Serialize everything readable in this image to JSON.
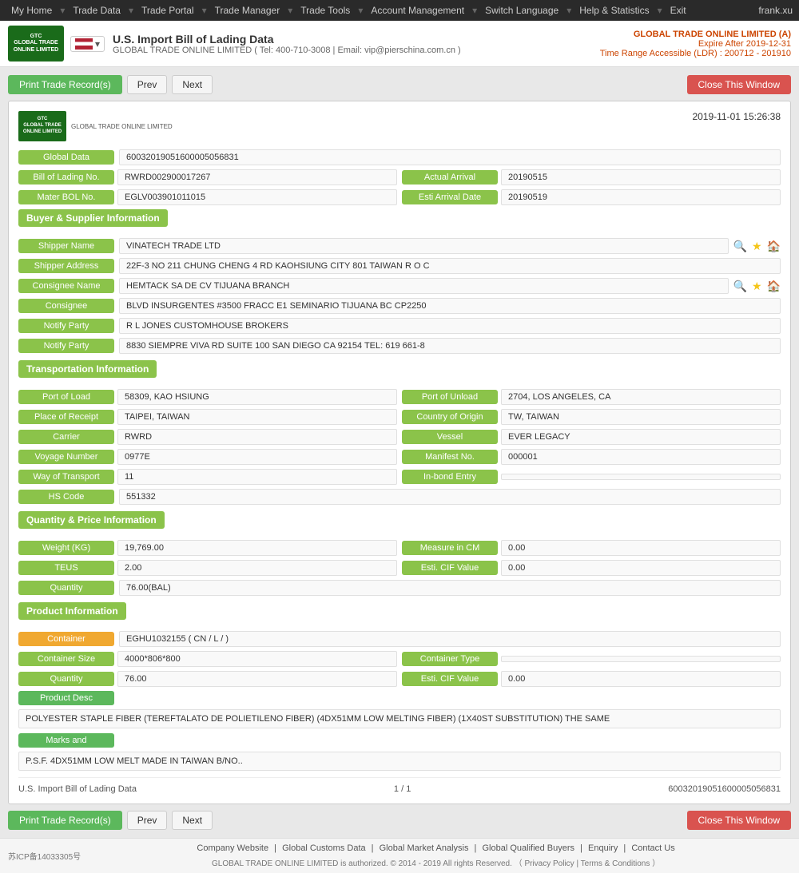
{
  "nav": {
    "items": [
      "My Home",
      "Trade Data",
      "Trade Portal",
      "Trade Manager",
      "Trade Tools",
      "Account Management",
      "Switch Language",
      "Help & Statistics",
      "Exit"
    ],
    "username": "frank.xu"
  },
  "header": {
    "title": "U.S. Import Bill of Lading Data",
    "subtitle": "GLOBAL TRADE ONLINE LIMITED ( Tel: 400-710-3008 | Email: vip@pierschina.com.cn )",
    "company": "GLOBAL TRADE ONLINE LIMITED (A)",
    "expire": "Expire After 2019-12-31",
    "ldr": "Time Range Accessible (LDR) : 200712 - 201910"
  },
  "toolbar": {
    "print_label": "Print Trade Record(s)",
    "prev_label": "Prev",
    "next_label": "Next",
    "close_label": "Close This Window"
  },
  "record": {
    "datetime": "2019-11-01 15:26:38",
    "global_data_label": "Global Data",
    "global_data_value": "60032019051600005056831",
    "bol_label": "Bill of Lading No.",
    "bol_value": "RWRD002900017267",
    "actual_arrival_label": "Actual Arrival",
    "actual_arrival_value": "20190515",
    "master_bol_label": "Mater BOL No.",
    "master_bol_value": "EGLV003901011015",
    "esti_arrival_label": "Esti Arrival Date",
    "esti_arrival_value": "20190519"
  },
  "buyer_supplier": {
    "section_label": "Buyer & Supplier Information",
    "shipper_name_label": "Shipper Name",
    "shipper_name_value": "VINATECH TRADE LTD",
    "shipper_address_label": "Shipper Address",
    "shipper_address_value": "22F-3 NO 211 CHUNG CHENG 4 RD KAOHSIUNG CITY 801 TAIWAN R O C",
    "consignee_name_label": "Consignee Name",
    "consignee_name_value": "HEMTACK SA DE CV TIJUANA BRANCH",
    "consignee_label": "Consignee",
    "consignee_value": "BLVD INSURGENTES #3500 FRACC E1 SEMINARIO TIJUANA BC CP2250",
    "notify1_label": "Notify Party",
    "notify1_value": "R L JONES CUSTOMHOUSE BROKERS",
    "notify2_label": "Notify Party",
    "notify2_value": "8830 SIEMPRE VIVA RD SUITE 100 SAN DIEGO CA 92154 TEL: 619 661-8"
  },
  "transportation": {
    "section_label": "Transportation Information",
    "port_load_label": "Port of Load",
    "port_load_value": "58309, KAO HSIUNG",
    "port_unload_label": "Port of Unload",
    "port_unload_value": "2704, LOS ANGELES, CA",
    "place_receipt_label": "Place of Receipt",
    "place_receipt_value": "TAIPEI, TAIWAN",
    "country_origin_label": "Country of Origin",
    "country_origin_value": "TW, TAIWAN",
    "carrier_label": "Carrier",
    "carrier_value": "RWRD",
    "vessel_label": "Vessel",
    "vessel_value": "EVER LEGACY",
    "voyage_label": "Voyage Number",
    "voyage_value": "0977E",
    "manifest_label": "Manifest No.",
    "manifest_value": "000001",
    "transport_label": "Way of Transport",
    "transport_value": "11",
    "inbond_label": "In-bond Entry",
    "inbond_value": "",
    "hs_label": "HS Code",
    "hs_value": "551332"
  },
  "quantity_price": {
    "section_label": "Quantity & Price Information",
    "weight_label": "Weight (KG)",
    "weight_value": "19,769.00",
    "measure_label": "Measure in CM",
    "measure_value": "0.00",
    "teus_label": "TEUS",
    "teus_value": "2.00",
    "cif_label": "Esti. CIF Value",
    "cif_value": "0.00",
    "quantity_label": "Quantity",
    "quantity_value": "76.00(BAL)"
  },
  "product": {
    "section_label": "Product Information",
    "container_label": "Container",
    "container_value": "EGHU1032155 ( CN / L / )",
    "container_size_label": "Container Size",
    "container_size_value": "4000*806*800",
    "container_type_label": "Container Type",
    "container_type_value": "",
    "quantity_label": "Quantity",
    "quantity_value": "76.00",
    "esti_cif_label": "Esti. CIF Value",
    "esti_cif_value": "0.00",
    "product_desc_label": "Product Desc",
    "product_desc_value": "POLYESTER STAPLE FIBER (TEREFTALATO DE POLIETILENO FIBER) (4DX51MM LOW MELTING FIBER) (1X40ST SUBSTITUTION) THE SAME",
    "marks_label": "Marks and",
    "marks_value": "P.S.F. 4DX51MM LOW MELT MADE IN TAIWAN B/NO.."
  },
  "card_footer": {
    "left": "U.S. Import Bill of Lading Data",
    "center": "1 / 1",
    "right": "60032019051600005056831"
  },
  "site_footer": {
    "icp": "苏ICP备14033305号",
    "links": [
      "Company Website",
      "Global Customs Data",
      "Global Market Analysis",
      "Global Qualified Buyers",
      "Enquiry",
      "Contact Us"
    ],
    "copyright": "GLOBAL TRADE ONLINE LIMITED is authorized. © 2014 - 2019 All rights Reserved.  （ Privacy Policy | Terms & Conditions ）"
  }
}
